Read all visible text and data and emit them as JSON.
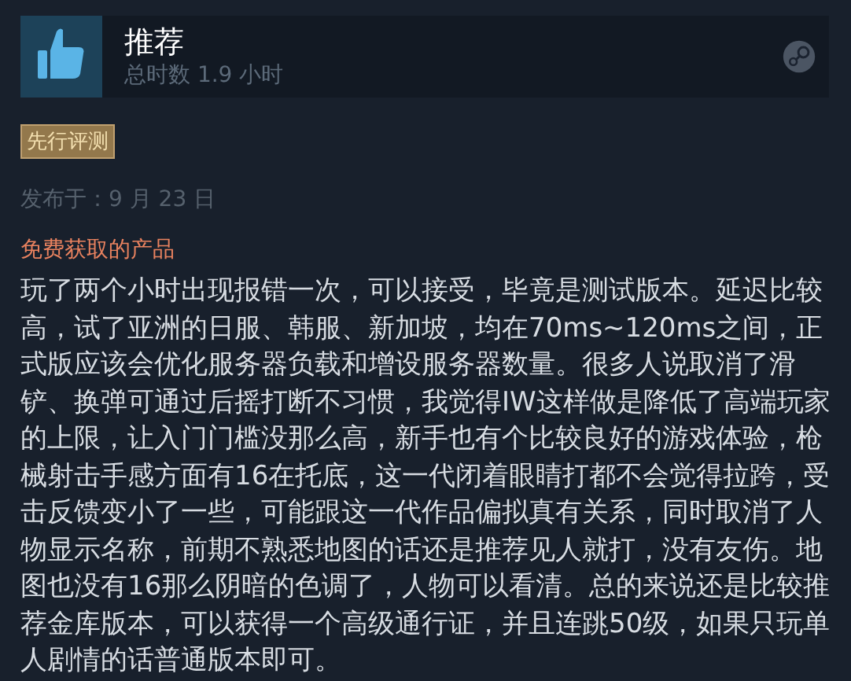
{
  "review": {
    "recommended": true,
    "verdict": "推荐",
    "playtime": "总时数 1.9 小时"
  },
  "tag": "先行评测",
  "posted": "发布于：9 月 23 日",
  "free_product_note": "免费获取的产品",
  "body": "玩了两个小时出现报错一次，可以接受，毕竟是测试版本。延迟比较高，试了亚洲的日服、韩服、新加坡，均在70ms~120ms之间，正式版应该会优化服务器负载和增设服务器数量。很多人说取消了滑铲、换弹可通过后摇打断不习惯，我觉得IW这样做是降低了高端玩家的上限，让入门门槛没那么高，新手也有个比较良好的游戏体验，枪械射击手感方面有16在托底，这一代闭着眼睛打都不会觉得拉跨，受击反馈变小了一些，可能跟这一代作品偏拟真有关系，同时取消了人物显示名称，前期不熟悉地图的话还是推荐见人就打，没有友伤。地图也没有16那么阴暗的色调了，人物可以看清。总的来说还是比较推荐金库版本，可以获得一个高级通行证，并且连跳50级，如果只玩单人剧情的话普通版本即可。"
}
